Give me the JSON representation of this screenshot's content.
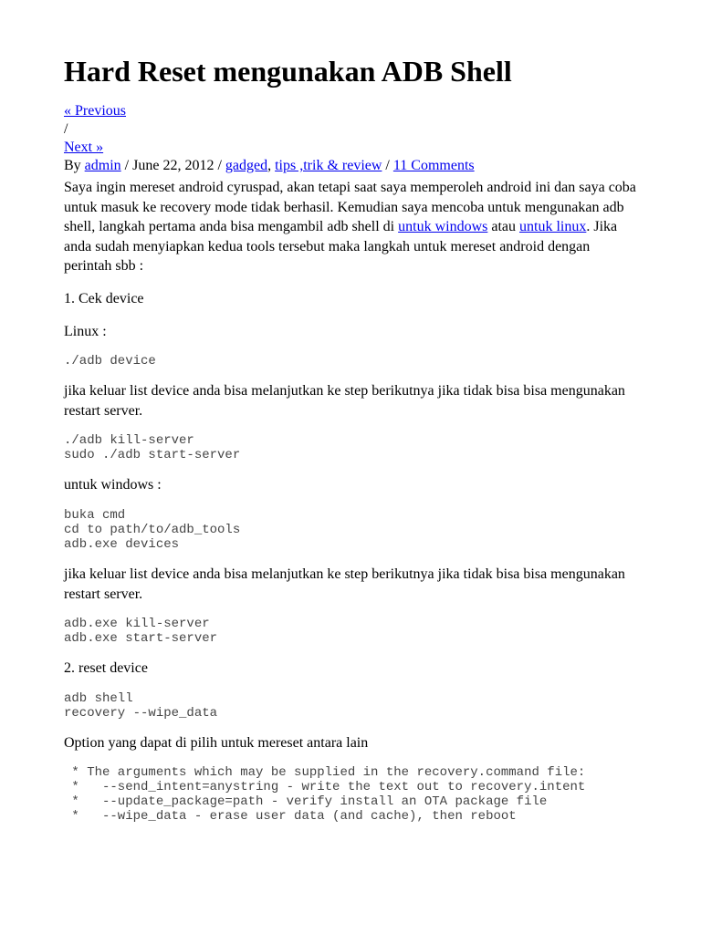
{
  "title": "Hard Reset mengunakan ADB Shell",
  "nav": {
    "previous": "« Previous",
    "separator": "/",
    "next": "Next »"
  },
  "byline": {
    "by": "By ",
    "author": "admin",
    "sep1": " / ",
    "date": "June 22, 2012",
    "sep2": " / ",
    "cat1": "gadged",
    "catSep": ", ",
    "cat2": "tips ,trik & review",
    "sep3": " / ",
    "comments": "11 Comments"
  },
  "intro": {
    "part1": "Saya ingin mereset android cyruspad, akan tetapi saat saya memperoleh android ini dan saya coba untuk masuk ke recovery mode tidak berhasil. Kemudian saya mencoba untuk mengunakan adb shell, langkah pertama anda bisa mengambil adb shell di ",
    "link1": "untuk windows",
    "mid": " atau ",
    "link2": "untuk linux",
    "part2": ". Jika anda sudah menyiapkan kedua tools tersebut maka langkah untuk mereset android dengan perintah sbb :"
  },
  "step1": "1. Cek device",
  "linuxLabel": "Linux :",
  "code1": "./adb device",
  "para1": "jika keluar list device anda bisa melanjutkan ke step berikutnya jika tidak bisa bisa mengunakan restart server.",
  "code2": "./adb kill-server\nsudo ./adb start-server",
  "windowsLabel": "untuk windows :",
  "code3": "buka cmd\ncd to path/to/adb_tools\nadb.exe devices",
  "para2": "jika keluar list device anda bisa melanjutkan ke step berikutnya jika tidak bisa bisa mengunakan restart server.",
  "code4": "adb.exe kill-server\nadb.exe start-server",
  "step2": "2. reset device",
  "code5": "adb shell\nrecovery --wipe_data",
  "para3": "Option yang dapat di pilih untuk mereset antara lain",
  "code6": " * The arguments which may be supplied in the recovery.command file:\n *   --send_intent=anystring - write the text out to recovery.intent\n *   --update_package=path - verify install an OTA package file\n *   --wipe_data - erase user data (and cache), then reboot"
}
